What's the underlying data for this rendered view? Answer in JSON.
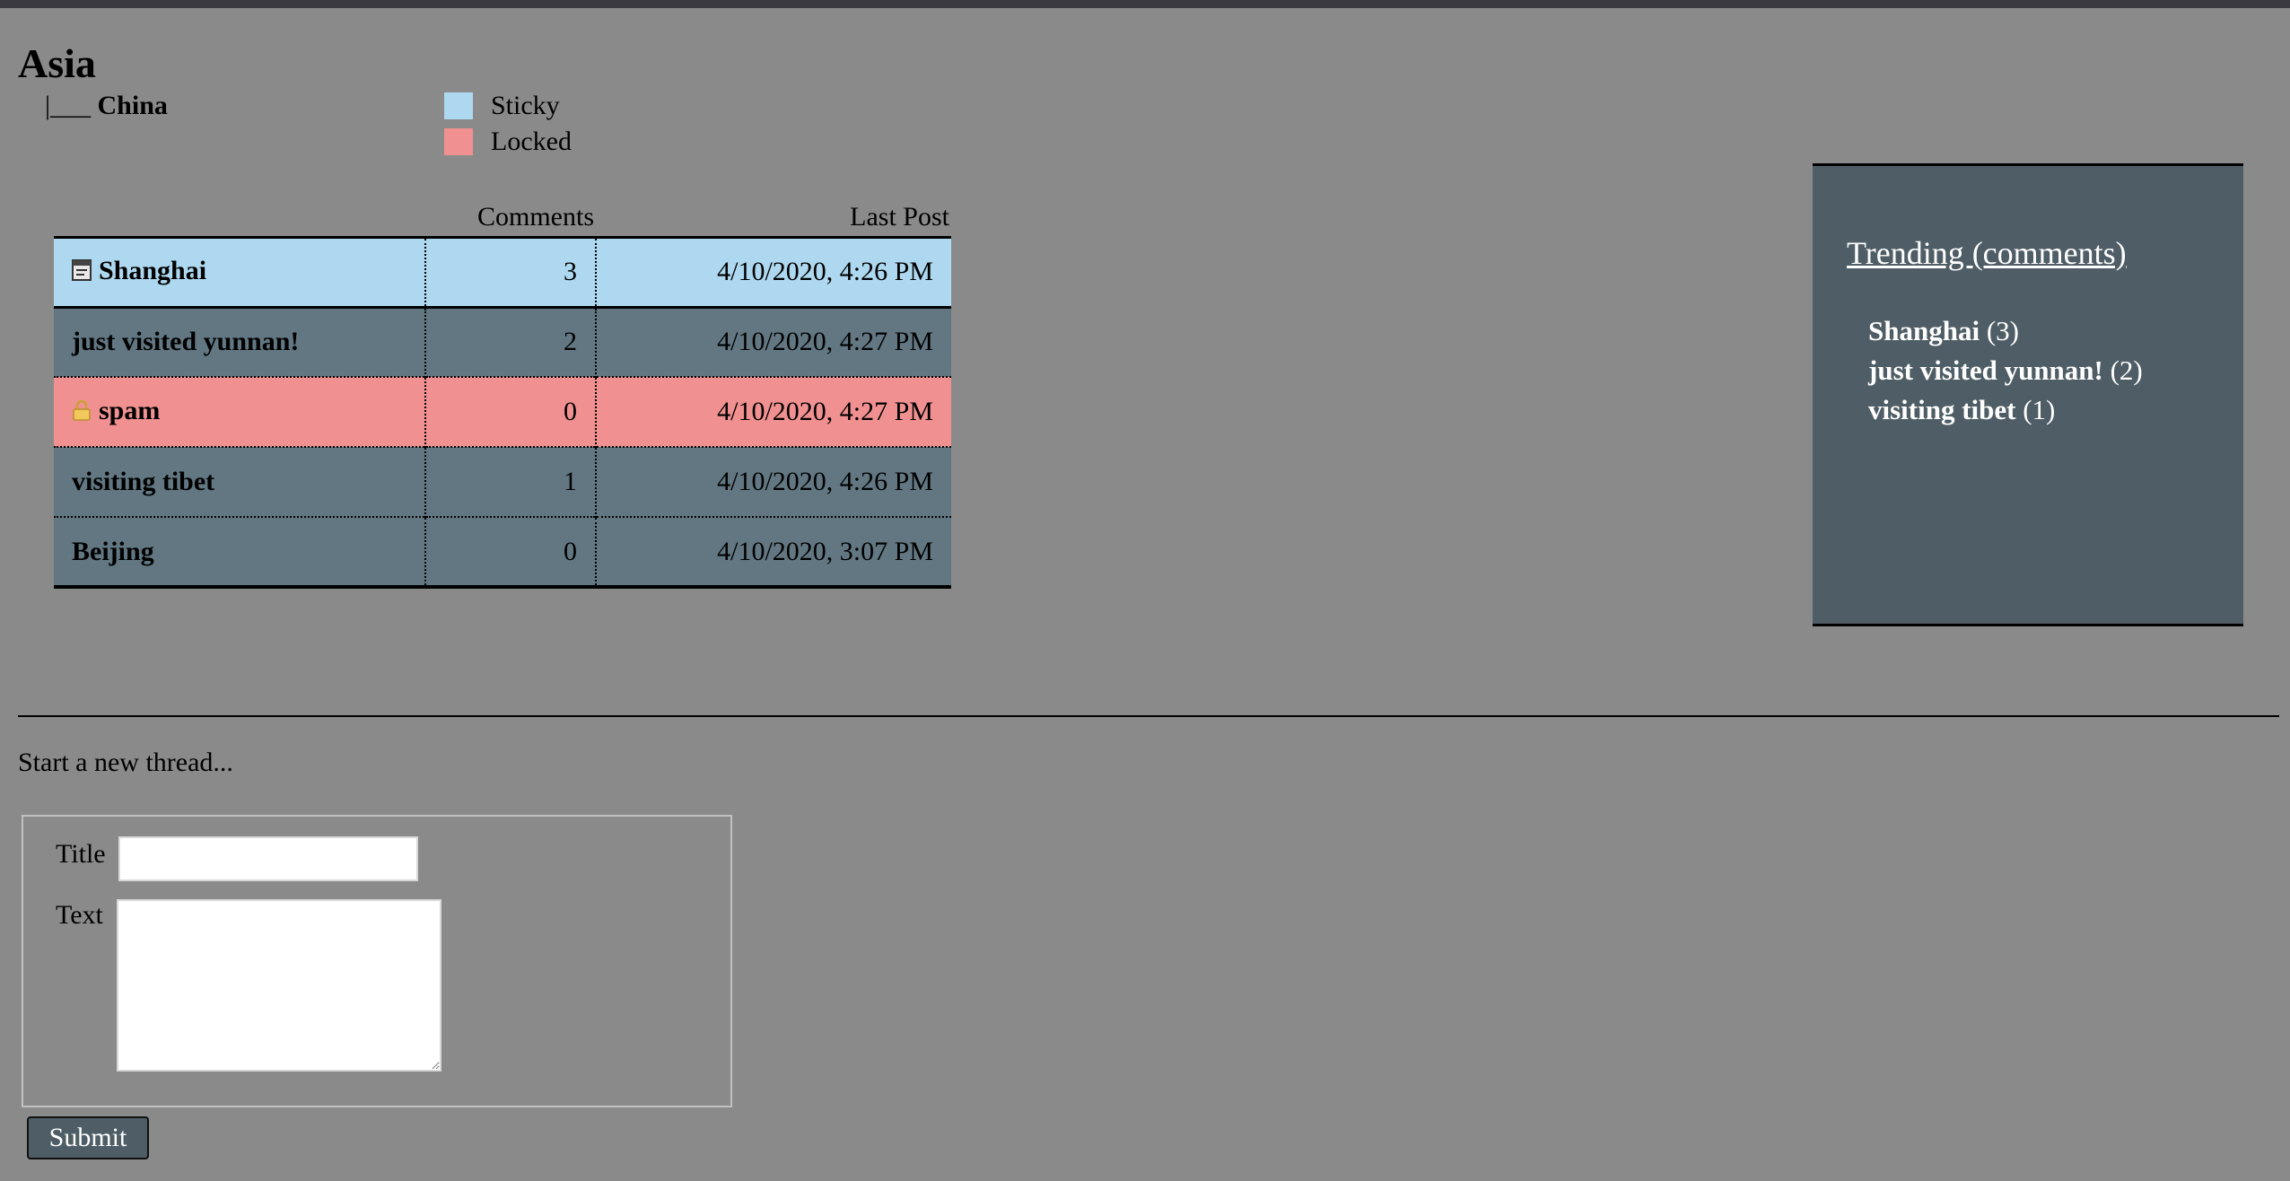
{
  "forum": {
    "title": "Asia",
    "breadcrumb_branch": "|___",
    "subforum": "China"
  },
  "legend": [
    {
      "label": "Sticky",
      "color": "#add8ef"
    },
    {
      "label": "Locked",
      "color": "#f09090"
    }
  ],
  "table": {
    "headers": {
      "title": "",
      "comments": "Comments",
      "last_post": "Last Post"
    },
    "rows": [
      {
        "title": "Shanghai",
        "comments": "3",
        "last_post": "4/10/2020, 4:26 PM",
        "status": "sticky",
        "icon": "sticky-note-icon"
      },
      {
        "title": "just visited yunnan!",
        "comments": "2",
        "last_post": "4/10/2020, 4:27 PM",
        "status": "normal"
      },
      {
        "title": "spam",
        "comments": "0",
        "last_post": "4/10/2020, 4:27 PM",
        "status": "locked",
        "icon": "lock-icon"
      },
      {
        "title": "visiting tibet",
        "comments": "1",
        "last_post": "4/10/2020, 4:26 PM",
        "status": "normal"
      },
      {
        "title": "Beijing",
        "comments": "0",
        "last_post": "4/10/2020, 3:07 PM",
        "status": "normal"
      }
    ]
  },
  "trending": {
    "title": "Trending (comments)",
    "items": [
      {
        "title": "Shanghai",
        "count": "(3)"
      },
      {
        "title": "just visited yunnan!",
        "count": "(2)"
      },
      {
        "title": "visiting tibet",
        "count": "(1)"
      }
    ]
  },
  "new_thread": {
    "prompt": "Start a new thread...",
    "title_label": "Title",
    "text_label": "Text",
    "title_value": "",
    "text_value": "",
    "submit_label": "Submit"
  }
}
